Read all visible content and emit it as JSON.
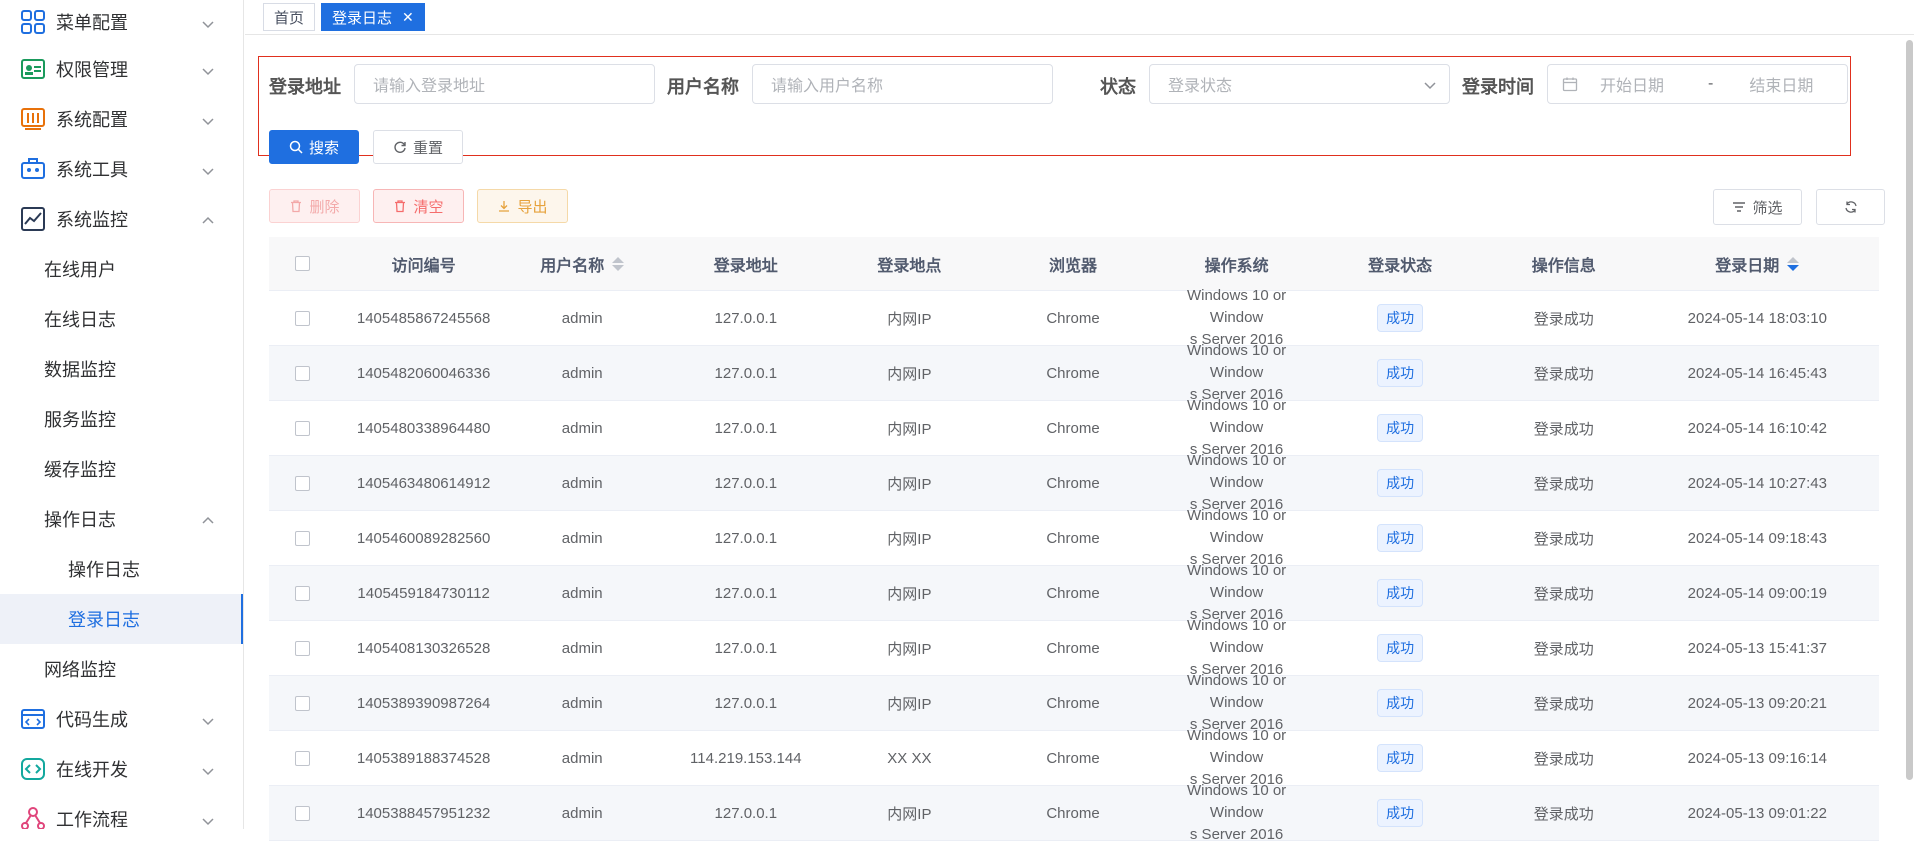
{
  "sidebar": {
    "items": [
      {
        "label": "菜单配置"
      },
      {
        "label": "权限管理"
      },
      {
        "label": "系统配置"
      },
      {
        "label": "系统工具"
      },
      {
        "label": "系统监控"
      },
      {
        "label": "在线用户"
      },
      {
        "label": "在线日志"
      },
      {
        "label": "数据监控"
      },
      {
        "label": "服务监控"
      },
      {
        "label": "缓存监控"
      },
      {
        "label": "操作日志"
      },
      {
        "label": "操作日志"
      },
      {
        "label": "登录日志"
      },
      {
        "label": "网络监控"
      },
      {
        "label": "代码生成"
      },
      {
        "label": "在线开发"
      },
      {
        "label": "工作流程"
      }
    ]
  },
  "tabs": [
    {
      "label": "首页"
    },
    {
      "label": "登录日志",
      "close": "✕"
    }
  ],
  "query": {
    "address_label": "登录地址",
    "address_placeholder": "请输入登录地址",
    "user_label": "用户名称",
    "user_placeholder": "请输入用户名称",
    "status_label": "状态",
    "status_placeholder": "登录状态",
    "time_label": "登录时间",
    "start_placeholder": "开始日期",
    "date_sep": "-",
    "end_placeholder": "结束日期",
    "search_btn": "搜索",
    "reset_btn": "重置"
  },
  "toolbar": {
    "delete": "删除",
    "clear": "清空",
    "export": "导出",
    "filter": "筛选"
  },
  "table": {
    "headers": [
      "访问编号",
      "用户名称",
      "登录地址",
      "登录地点",
      "浏览器",
      "操作系统",
      "登录状态",
      "操作信息",
      "登录日期"
    ],
    "rows": [
      {
        "id": "1405485867245568",
        "user": "admin",
        "addr": "127.0.0.1",
        "loc": "内网IP",
        "browser": "Chrome",
        "os1": "Windows 10 or Window",
        "os2": "s Server 2016",
        "status": "成功",
        "msg": "登录成功",
        "date": "2024-05-14 18:03:10"
      },
      {
        "id": "1405482060046336",
        "user": "admin",
        "addr": "127.0.0.1",
        "loc": "内网IP",
        "browser": "Chrome",
        "os1": "Windows 10 or Window",
        "os2": "s Server 2016",
        "status": "成功",
        "msg": "登录成功",
        "date": "2024-05-14 16:45:43"
      },
      {
        "id": "1405480338964480",
        "user": "admin",
        "addr": "127.0.0.1",
        "loc": "内网IP",
        "browser": "Chrome",
        "os1": "Windows 10 or Window",
        "os2": "s Server 2016",
        "status": "成功",
        "msg": "登录成功",
        "date": "2024-05-14 16:10:42"
      },
      {
        "id": "1405463480614912",
        "user": "admin",
        "addr": "127.0.0.1",
        "loc": "内网IP",
        "browser": "Chrome",
        "os1": "Windows 10 or Window",
        "os2": "s Server 2016",
        "status": "成功",
        "msg": "登录成功",
        "date": "2024-05-14 10:27:43"
      },
      {
        "id": "1405460089282560",
        "user": "admin",
        "addr": "127.0.0.1",
        "loc": "内网IP",
        "browser": "Chrome",
        "os1": "Windows 10 or Window",
        "os2": "s Server 2016",
        "status": "成功",
        "msg": "登录成功",
        "date": "2024-05-14 09:18:43"
      },
      {
        "id": "1405459184730112",
        "user": "admin",
        "addr": "127.0.0.1",
        "loc": "内网IP",
        "browser": "Chrome",
        "os1": "Windows 10 or Window",
        "os2": "s Server 2016",
        "status": "成功",
        "msg": "登录成功",
        "date": "2024-05-14 09:00:19"
      },
      {
        "id": "1405408130326528",
        "user": "admin",
        "addr": "127.0.0.1",
        "loc": "内网IP",
        "browser": "Chrome",
        "os1": "Windows 10 or Window",
        "os2": "s Server 2016",
        "status": "成功",
        "msg": "登录成功",
        "date": "2024-05-13 15:41:37"
      },
      {
        "id": "1405389390987264",
        "user": "admin",
        "addr": "127.0.0.1",
        "loc": "内网IP",
        "browser": "Chrome",
        "os1": "Windows 10 or Window",
        "os2": "s Server 2016",
        "status": "成功",
        "msg": "登录成功",
        "date": "2024-05-13 09:20:21"
      },
      {
        "id": "1405389188374528",
        "user": "admin",
        "addr": "114.219.153.144",
        "loc": "XX XX",
        "browser": "Chrome",
        "os1": "Windows 10 or Window",
        "os2": "s Server 2016",
        "status": "成功",
        "msg": "登录成功",
        "date": "2024-05-13 09:16:14"
      },
      {
        "id": "1405388457951232",
        "user": "admin",
        "addr": "127.0.0.1",
        "loc": "内网IP",
        "browser": "Chrome",
        "os1": "Windows 10 or Window",
        "os2": "s Server 2016",
        "status": "成功",
        "msg": "登录成功",
        "date": "2024-05-13 09:01:22"
      }
    ]
  },
  "colors": {
    "primary": "#1f6fe0",
    "danger": "#f56c6c",
    "warning": "#e6a23c",
    "highlight_box": "#e0301e"
  }
}
